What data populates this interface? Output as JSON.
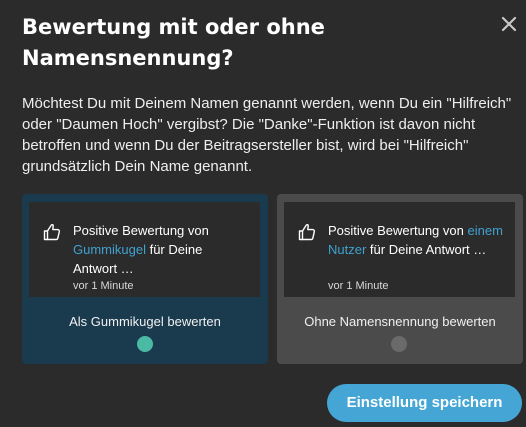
{
  "dialog": {
    "title": "Bewertung mit oder ohne Namensnennung?",
    "description": "Möchtest Du mit Deinem Namen genannt werden, wenn Du ein \"Hilfreich\" oder \"Daumen Hoch\" vergibst? Die \"Danke\"-Funktion ist davon nicht betroffen und wenn Du der Beitragsersteller bist, wird bei \"Hilfreich\" grundsätzlich Dein Name genannt.",
    "close_icon": "close-icon"
  },
  "options": [
    {
      "notification_prefix": "Positive Bewertung von",
      "name": "Gummikugel",
      "notification_suffix": "für Deine Antwort …",
      "time": "vor 1 Minute",
      "label": "Als Gummikugel bewerten",
      "selected": true,
      "icon": "thumbs-up-icon"
    },
    {
      "notification_prefix": "Positive Bewertung von",
      "name": "einem Nutzer",
      "notification_suffix": "für Deine Antwort …",
      "time": "vor 1 Minute",
      "label": "Ohne Namensnennung bewerten",
      "selected": false,
      "icon": "thumbs-up-icon"
    }
  ],
  "footer": {
    "save_label": "Einstellung speichern"
  },
  "colors": {
    "background": "#2b2b2b",
    "selected_card": "#1a3a4e",
    "unselected_card": "#4b4b4b",
    "link": "#3fa2d2",
    "radio_selected": "#4bb9a4",
    "radio_unselected": "#6a6a6a",
    "primary_button": "#45a6d6"
  }
}
